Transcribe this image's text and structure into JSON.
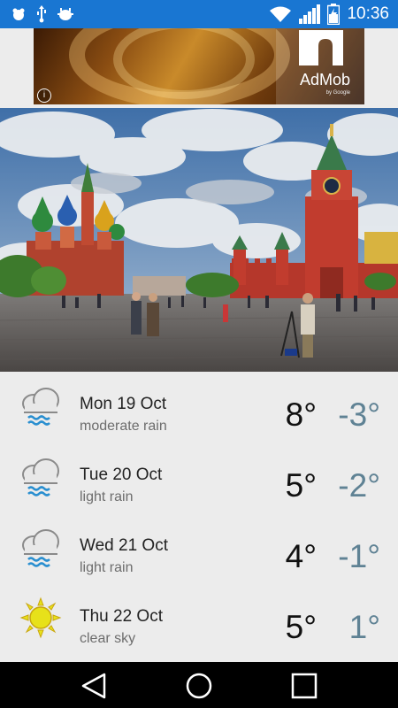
{
  "status_bar": {
    "time": "10:36",
    "icons": [
      "notification-icon",
      "usb-icon",
      "android-debug-icon",
      "wifi-icon",
      "signal-icon",
      "battery-charging-icon"
    ],
    "background": "#1976d2"
  },
  "ad": {
    "brand": "AdMob",
    "byline": "by Google",
    "info_symbol": "i"
  },
  "forecast": [
    {
      "day": "Mon 19 Oct",
      "condition": "moderate rain",
      "high": "8°",
      "low": "-3°",
      "icon": "rain-cloud-icon"
    },
    {
      "day": "Tue 20 Oct",
      "condition": "light rain",
      "high": "5°",
      "low": "-2°",
      "icon": "rain-cloud-icon"
    },
    {
      "day": "Wed 21 Oct",
      "condition": "light rain",
      "high": "4°",
      "low": "-1°",
      "icon": "rain-cloud-icon"
    },
    {
      "day": "Thu 22 Oct",
      "condition": "clear sky",
      "high": "5°",
      "low": "1°",
      "icon": "sun-icon"
    }
  ],
  "colors": {
    "low_temp": "#5f8294",
    "rain_drops": "#2a8fd0",
    "sun": "#e7e11a"
  }
}
